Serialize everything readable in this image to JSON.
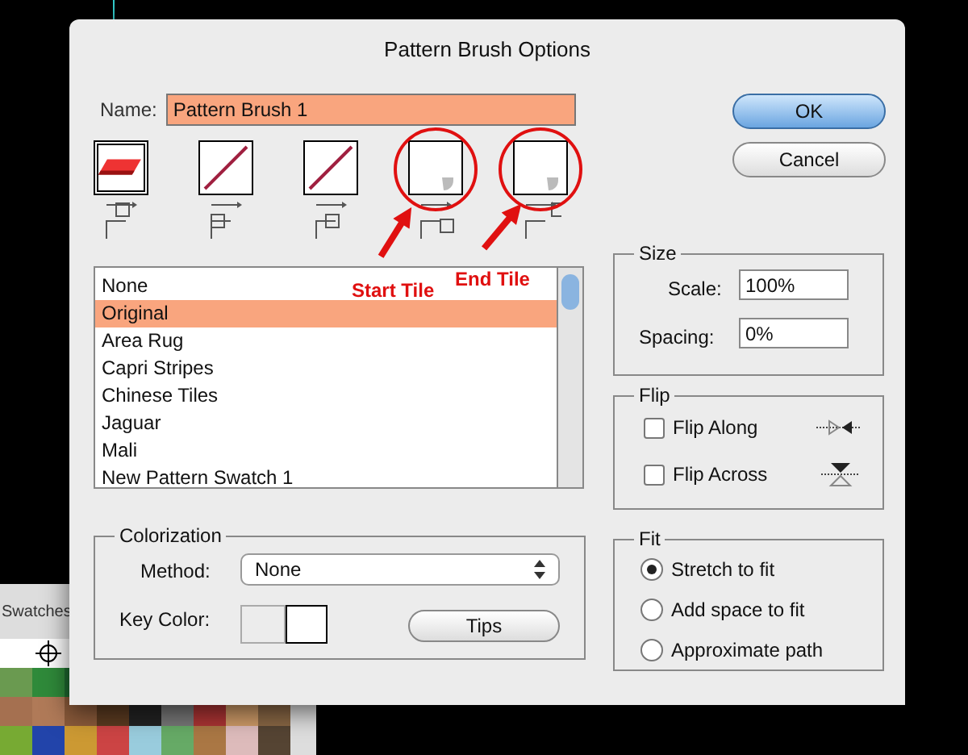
{
  "window": {
    "title": "Pattern Brush Options"
  },
  "swatches_panel": {
    "title": "Swatches"
  },
  "name_field": {
    "label": "Name:",
    "value": "Pattern Brush 1"
  },
  "buttons": [
    {
      "label": "OK",
      "default": true
    },
    {
      "label": "Cancel",
      "default": false
    }
  ],
  "tiles": [
    {
      "kind": "side",
      "selected": true,
      "circled": false
    },
    {
      "kind": "outer_corner",
      "selected": false,
      "circled": false
    },
    {
      "kind": "inner_corner",
      "selected": false,
      "circled": false
    },
    {
      "kind": "start",
      "selected": false,
      "circled": true
    },
    {
      "kind": "end",
      "selected": false,
      "circled": true
    }
  ],
  "annotations": [
    {
      "label": "Start Tile"
    },
    {
      "label": "End Tile"
    }
  ],
  "patterns": [
    {
      "label": "None",
      "selected": false
    },
    {
      "label": "Original",
      "selected": true
    },
    {
      "label": "Area Rug",
      "selected": false
    },
    {
      "label": "Capri Stripes",
      "selected": false
    },
    {
      "label": "Chinese Tiles",
      "selected": false
    },
    {
      "label": "Jaguar",
      "selected": false
    },
    {
      "label": "Mali",
      "selected": false
    },
    {
      "label": "New Pattern Swatch 1",
      "selected": false
    }
  ],
  "colorization": {
    "title": "Colorization",
    "method_label": "Method:",
    "method": "None",
    "key_color_label": "Key Color:",
    "tips_button": "Tips"
  },
  "size": {
    "title": "Size",
    "scale_label": "Scale:",
    "scale": "100%",
    "spacing_label": "Spacing:",
    "spacing": "0%"
  },
  "flip": {
    "title": "Flip",
    "options": [
      {
        "label": "Flip Along",
        "checked": false
      },
      {
        "label": "Flip Across",
        "checked": false
      }
    ]
  },
  "fit": {
    "title": "Fit",
    "options": [
      {
        "label": "Stretch to fit",
        "selected": true
      },
      {
        "label": "Add space to fit",
        "selected": false
      },
      {
        "label": "Approximate path",
        "selected": false
      }
    ]
  }
}
